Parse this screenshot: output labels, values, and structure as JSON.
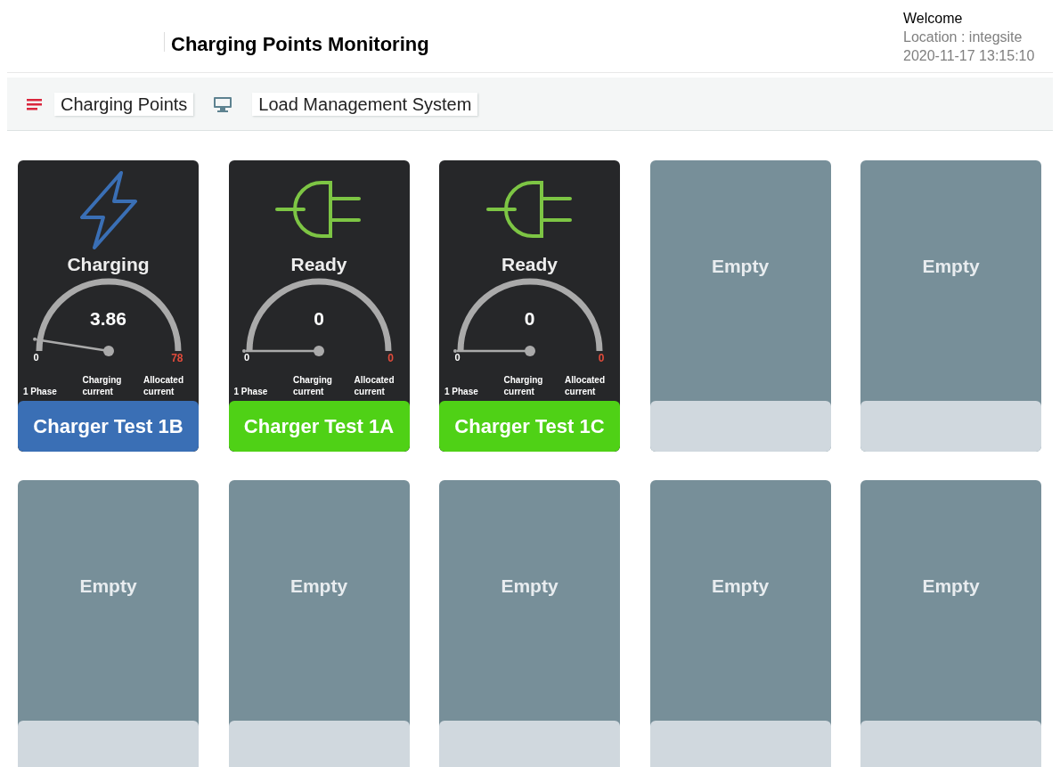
{
  "header": {
    "title": "Charging Points Monitoring",
    "welcome": "Welcome",
    "location": "Location : integsite",
    "datetime": "2020-11-17 13:15:10"
  },
  "nav": [
    {
      "label": "Charging Points"
    },
    {
      "label": "Load Management System"
    }
  ],
  "chargers": [
    {
      "kind": "charging",
      "status": "Charging",
      "reading": "3.86",
      "level": 0.05,
      "min": "0",
      "max": "78",
      "phase": "1 Phase",
      "current_label": "Charging current",
      "allocated_label": "Allocated current",
      "name": "Charger Test 1B"
    },
    {
      "kind": "ready",
      "status": "Ready",
      "reading": "0",
      "level": 0,
      "min": "0",
      "max": "0",
      "phase": "1 Phase",
      "current_label": "Charging current",
      "allocated_label": "Allocated current",
      "name": "Charger Test 1A"
    },
    {
      "kind": "ready",
      "status": "Ready",
      "reading": "0",
      "level": 0,
      "min": "0",
      "max": "0",
      "phase": "1 Phase",
      "current_label": "Charging current",
      "allocated_label": "Allocated current",
      "name": "Charger Test 1C"
    },
    {
      "kind": "empty",
      "status": "Empty"
    },
    {
      "kind": "empty",
      "status": "Empty"
    },
    {
      "kind": "empty",
      "status": "Empty"
    },
    {
      "kind": "empty",
      "status": "Empty"
    },
    {
      "kind": "empty",
      "status": "Empty"
    },
    {
      "kind": "empty",
      "status": "Empty"
    },
    {
      "kind": "empty",
      "status": "Empty"
    }
  ]
}
